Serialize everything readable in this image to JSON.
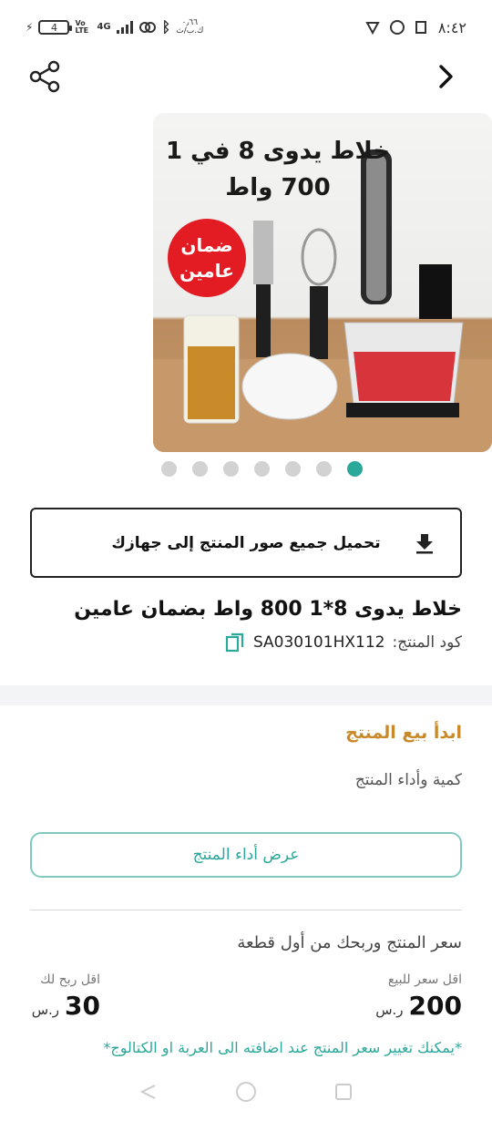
{
  "status_bar": {
    "battery_level": "4",
    "net_speed_line1": "٠٫٦٦",
    "net_speed_line2": "ك.ب/ث",
    "network_type": "4G",
    "volte": "Vo LTE",
    "time": "٨:٤٢"
  },
  "product_image": {
    "headline_line1": "خلاط يدوى 8 في 1",
    "headline_line2": "700 واط",
    "badge_line1": "ضمان",
    "badge_line2": "عامين"
  },
  "carousel": {
    "total": 7,
    "active_index": 6
  },
  "download_button": {
    "label": "تحميل جميع صور المنتج إلى جهازك"
  },
  "product": {
    "title": "خلاط يدوى 8*1 800 واط  بضمان عامين",
    "code_label": "كود المنتج:",
    "code_value": "SA030101HX112"
  },
  "selling": {
    "heading": "ابدأ بيع المنتج",
    "qty_performance": "كمية وأداء المنتج",
    "performance_button": "عرض أداء المنتج"
  },
  "pricing": {
    "heading": "سعر المنتج وربحك من أول قطعة",
    "min_price_label": "اقل سعر للبيع",
    "min_price_value": "200",
    "min_profit_label": "اقل ربح لك",
    "min_profit_value": "30",
    "currency": "ر.س",
    "note": "*يمكنك تغيير سعر المنتج عند اضافته الى العربة او الكتالوج*"
  },
  "colors": {
    "accent": "#2aa89a",
    "heading_orange": "#c8892a",
    "badge_red": "#e31b23"
  },
  "icons": [
    "share-icon",
    "chevron-right-icon",
    "download-icon",
    "copy-icon",
    "nav-back-icon",
    "nav-home-icon",
    "nav-recents-icon"
  ]
}
